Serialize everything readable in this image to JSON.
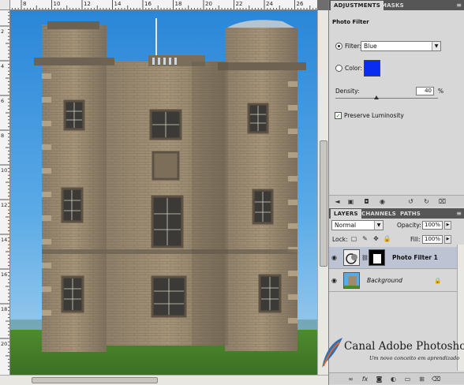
{
  "rulers": {
    "top_labels": [
      "8",
      "10",
      "12",
      "14",
      "16",
      "18",
      "20",
      "22",
      "24",
      "26"
    ],
    "left_labels": [
      "2",
      "4",
      "6",
      "8",
      "10",
      "12",
      "14",
      "16",
      "18",
      "20"
    ]
  },
  "adjustments": {
    "tabs": [
      "ADJUSTMENTS",
      "MASKS"
    ],
    "active_tab": "ADJUSTMENTS",
    "title": "Photo Filter",
    "filter_label": "Filter:",
    "filter_value": "Blue",
    "filter_selected": true,
    "color_label": "Color:",
    "color_value": "#0a2cf0",
    "density_label": "Density:",
    "density_value": "40",
    "density_unit": "%",
    "density_fraction": 0.4,
    "preserve_label": "Preserve Luminosity",
    "preserve_checked": true,
    "footer_icons": [
      "back-icon",
      "expand-icon",
      "clip-icon",
      "visibility-icon",
      "reset-previous-icon",
      "reset-icon",
      "delete-icon"
    ]
  },
  "layers": {
    "tabs": [
      "LAYERS",
      "CHANNELS",
      "PATHS"
    ],
    "active_tab": "LAYERS",
    "blend_mode": "Normal",
    "opacity_label": "Opacity:",
    "opacity_value": "100%",
    "lock_label": "Lock:",
    "fill_label": "Fill:",
    "fill_value": "100%",
    "items": [
      {
        "name": "Photo Filter 1",
        "selected": true,
        "visible": true
      },
      {
        "name": "Background",
        "selected": false,
        "visible": true,
        "locked": true
      }
    ],
    "footer_icons": [
      "link-icon",
      "fx-icon",
      "mask-icon",
      "adjustment-icon",
      "folder-icon",
      "new-layer-icon",
      "trash-icon"
    ]
  },
  "watermark": {
    "title": "Canal Adobe Photoshop",
    "subtitle": "Um novo conceito em aprendizado"
  }
}
